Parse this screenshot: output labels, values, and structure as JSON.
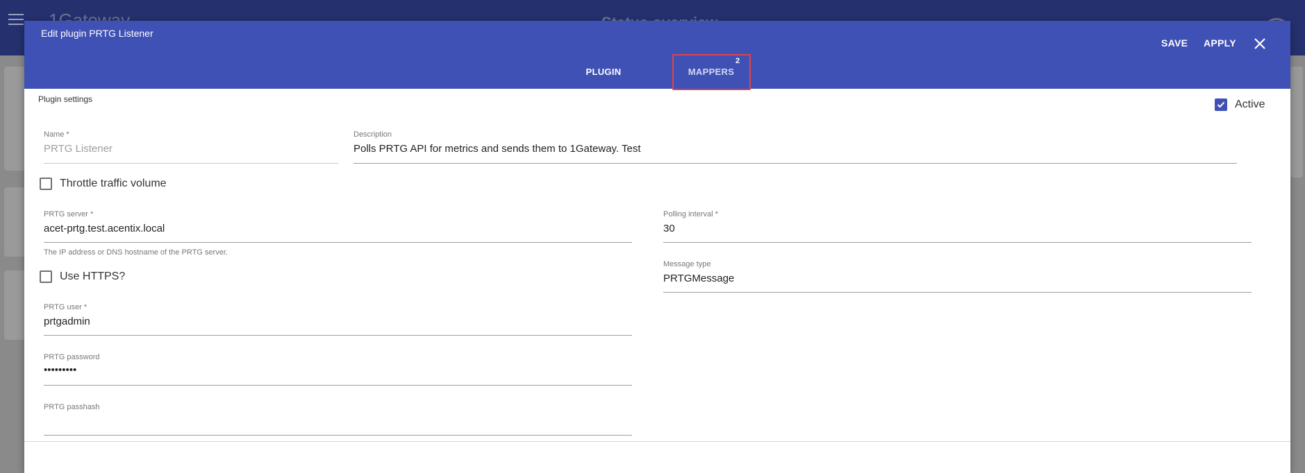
{
  "background": {
    "logo": "1Gateway",
    "title": "Status overview"
  },
  "dialog": {
    "title": "Edit plugin PRTG Listener",
    "save_label": "SAVE",
    "apply_label": "APPLY"
  },
  "tabs": {
    "plugin": "PLUGIN",
    "mappers": "MAPPERS",
    "mappers_badge": "2"
  },
  "form": {
    "section_label": "Plugin settings",
    "active_label": "Active",
    "active_checked": true,
    "name": {
      "label": "Name *",
      "value": "PRTG Listener"
    },
    "description": {
      "label": "Description",
      "value": "Polls PRTG API for metrics and sends them to 1Gateway. Test"
    },
    "throttle_label": "Throttle traffic volume",
    "prtg_server": {
      "label": "PRTG server *",
      "value": "acet-prtg.test.acentix.local",
      "hint": "The IP address or DNS hostname of the PRTG server."
    },
    "polling_interval": {
      "label": "Polling interval *",
      "value": "30"
    },
    "use_https_label": "Use HTTPS?",
    "message_type": {
      "label": "Message type",
      "value": "PRTGMessage"
    },
    "prtg_user": {
      "label": "PRTG user *",
      "value": "prtgadmin"
    },
    "prtg_password": {
      "label": "PRTG password",
      "value": "•••••••••"
    },
    "prtg_passhash": {
      "label": "PRTG passhash",
      "value": ""
    }
  },
  "colors": {
    "primary": "#3f51b5",
    "highlight": "#e0424a"
  }
}
